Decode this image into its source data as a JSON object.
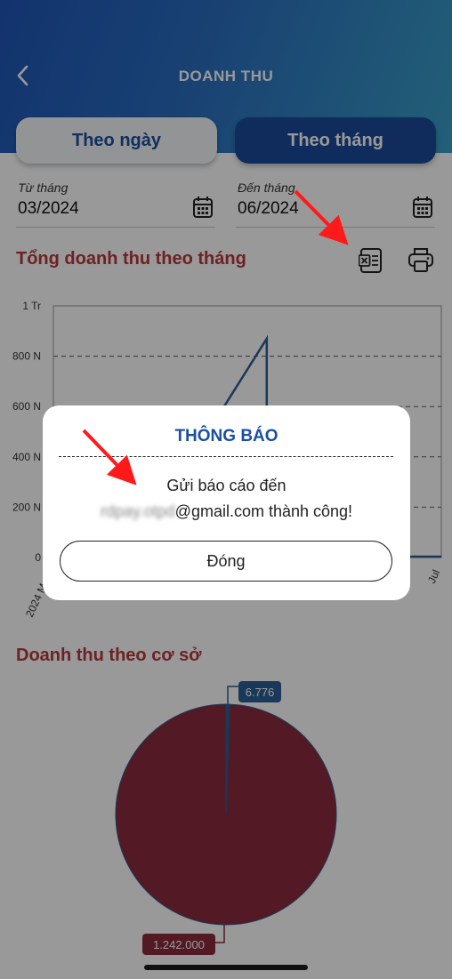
{
  "header": {
    "title": "DOANH THU",
    "back_icon": "chevron-left-icon"
  },
  "tabs": [
    {
      "label": "Theo ngày",
      "active": false
    },
    {
      "label": "Theo tháng",
      "active": true
    }
  ],
  "filters": {
    "from": {
      "label": "Từ tháng",
      "value": "03/2024"
    },
    "to": {
      "label": "Đến tháng",
      "value": "06/2024"
    }
  },
  "revenue_by_month": {
    "title": "Tổng doanh thu theo tháng",
    "actions": [
      "excel-export-icon",
      "printer-icon"
    ]
  },
  "revenue_by_base": {
    "title": "Doanh thu theo cơ sở"
  },
  "chart_data": [
    {
      "type": "line",
      "title": "",
      "yticks": [
        "0",
        "200 N",
        "400 N",
        "600 N",
        "800 N",
        "1 Tr"
      ],
      "ylim": [
        0,
        1000000
      ],
      "xticks_visible": [
        "2024 M",
        "Jul"
      ],
      "grid": "dashed-horizontal",
      "series": [
        {
          "color": "#2c5f94",
          "points": [
            [
              0.44,
              0.6
            ],
            [
              0.55,
              0.87
            ],
            [
              0.55,
              0.0
            ]
          ]
        }
      ]
    },
    {
      "type": "pie",
      "slices": [
        {
          "label": "6.776",
          "value": 6776,
          "color": "#2c5f94"
        },
        {
          "label": "1.242.000",
          "value": 1242000,
          "color": "#8a2b3d"
        }
      ]
    }
  ],
  "dialog": {
    "title": "THÔNG BÁO",
    "line1": "Gửi báo cáo đến",
    "email_blurred": "rdpay.otpd",
    "email_domain": "@gmail.com thành công!",
    "close_label": "Đóng"
  },
  "colors": {
    "primary": "#1b4fa0",
    "accent_red": "#b8373a",
    "header_gradient": [
      "#1f56b8",
      "#3a9fc8"
    ],
    "pie_main": "#8a2b3d",
    "pie_small": "#2c5f94"
  }
}
